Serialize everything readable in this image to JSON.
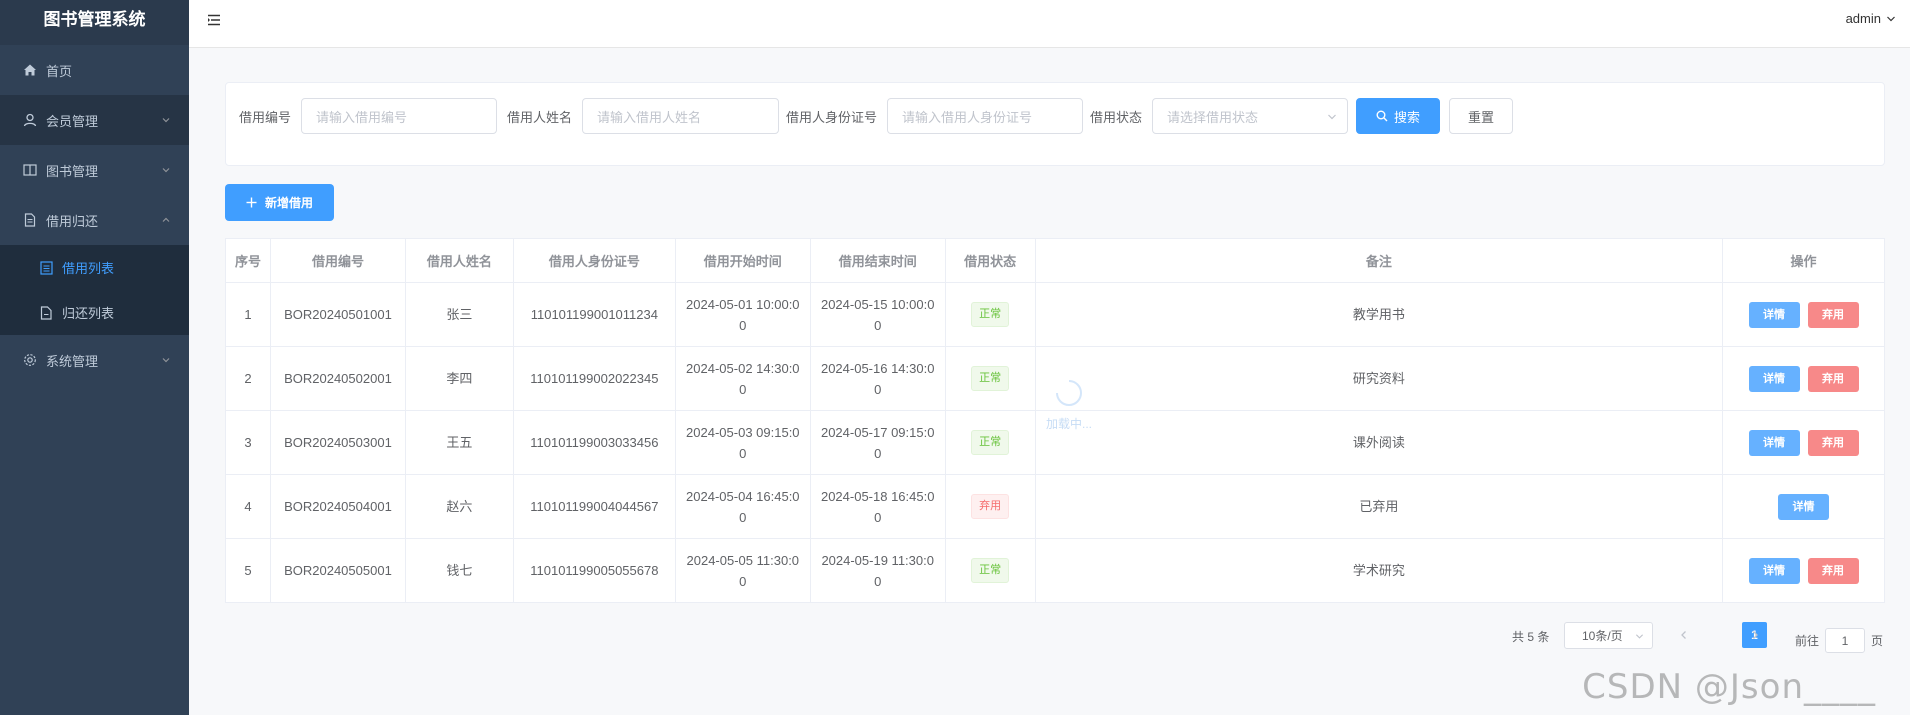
{
  "sidebar": {
    "title": "图书管理系统",
    "items": [
      {
        "label": "首页"
      },
      {
        "label": "会员管理"
      },
      {
        "label": "图书管理"
      },
      {
        "label": "借用归还"
      },
      {
        "label": "借用列表"
      },
      {
        "label": "归还列表"
      },
      {
        "label": "系统管理"
      }
    ]
  },
  "header": {
    "user": "admin"
  },
  "search": {
    "borrow_no_label": "借用编号",
    "borrow_no_placeholder": "请输入借用编号",
    "name_label": "借用人姓名",
    "name_placeholder": "请输入借用人姓名",
    "id_label": "借用人身份证号",
    "id_placeholder": "请输入借用人身份证号",
    "status_label": "借用状态",
    "status_placeholder": "请选择借用状态",
    "search_button": "搜索",
    "reset_button": "重置"
  },
  "toolbar": {
    "add_button": "新增借用"
  },
  "table": {
    "columns": [
      "序号",
      "借用编号",
      "借用人姓名",
      "借用人身份证号",
      "借用开始时间",
      "借用结束时间",
      "借用状态",
      "备注",
      "操作"
    ],
    "rows": [
      {
        "index": "1",
        "no": "BOR20240501001",
        "name": "张三",
        "id_number": "110101199001011234",
        "start_a": "2024-05-01 10:00:0",
        "start_b": "0",
        "end_a": "2024-05-15 10:00:0",
        "end_b": "0",
        "status": "正常",
        "remark": "教学用书",
        "detail": "详情",
        "discard": "弃用"
      },
      {
        "index": "2",
        "no": "BOR20240502001",
        "name": "李四",
        "id_number": "110101199002022345",
        "start_a": "2024-05-02 14:30:0",
        "start_b": "0",
        "end_a": "2024-05-16 14:30:0",
        "end_b": "0",
        "status": "正常",
        "remark": "研究资料",
        "detail": "详情",
        "discard": "弃用"
      },
      {
        "index": "3",
        "no": "BOR20240503001",
        "name": "王五",
        "id_number": "110101199003033456",
        "start_a": "2024-05-03 09:15:0",
        "start_b": "0",
        "end_a": "2024-05-17 09:15:0",
        "end_b": "0",
        "status": "正常",
        "remark": "课外阅读",
        "detail": "详情",
        "discard": "弃用"
      },
      {
        "index": "4",
        "no": "BOR20240504001",
        "name": "赵六",
        "id_number": "110101199004044567",
        "start_a": "2024-05-04 16:45:0",
        "start_b": "0",
        "end_a": "2024-05-18 16:45:0",
        "end_b": "0",
        "status": "弃用",
        "remark": "已弃用",
        "detail": "详情",
        "discard": ""
      },
      {
        "index": "5",
        "no": "BOR20240505001",
        "name": "钱七",
        "id_number": "110101199005055678",
        "start_a": "2024-05-05 11:30:0",
        "start_b": "0",
        "end_a": "2024-05-19 11:30:0",
        "end_b": "0",
        "status": "正常",
        "remark": "学术研究",
        "detail": "详情",
        "discard": "弃用"
      }
    ]
  },
  "loading": {
    "text": "加载中..."
  },
  "pagination": {
    "total": "共 5 条",
    "page_size": "10条/页",
    "current_page": "1",
    "goto_prefix": "前往",
    "goto_value": "1",
    "goto_suffix": "页"
  },
  "watermark": "CSDN @Json____"
}
